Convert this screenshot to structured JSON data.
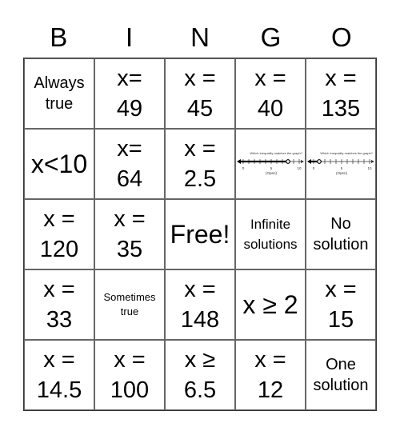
{
  "header": {
    "letters": [
      "B",
      "I",
      "N",
      "G",
      "O"
    ]
  },
  "cells": [
    {
      "text": "Always\ntrue",
      "size": "md"
    },
    {
      "text": "x=\n49",
      "size": "xl"
    },
    {
      "text": "x =\n45",
      "size": "xl"
    },
    {
      "text": "x =\n40",
      "size": "xl"
    },
    {
      "text": "x =\n135",
      "size": "xl"
    },
    {
      "text": "x<10",
      "size": "lg"
    },
    {
      "text": "x=\n64",
      "size": "xl"
    },
    {
      "text": "x =\n2.5",
      "size": "xl"
    },
    {
      "type": "numberline",
      "caption": "Which inequality matches the graph?",
      "circle_at": 8,
      "circle": "open",
      "direction": "left",
      "min": 0,
      "max": 10,
      "ticks": [
        "0",
        "5",
        "10"
      ],
      "label": "(Open)"
    },
    {
      "type": "numberline",
      "caption": "Which inequality matches the graph?",
      "circle_at": 1,
      "circle": "open",
      "direction": "left",
      "min": 0,
      "max": 10,
      "ticks": [
        "0",
        "5",
        "10"
      ],
      "label": "(Open)"
    },
    {
      "text": "x =\n120",
      "size": "xl"
    },
    {
      "text": "x =\n35",
      "size": "xl"
    },
    {
      "text": "Free!",
      "size": "lg"
    },
    {
      "text": "Infinite\nsolutions",
      "size": "sm"
    },
    {
      "text": "No\nsolution",
      "size": "md"
    },
    {
      "text": "x =\n33",
      "size": "xl"
    },
    {
      "text": "Sometimes\ntrue",
      "size": "xs"
    },
    {
      "text": "x =\n148",
      "size": "xl"
    },
    {
      "text": "x ≥ 2",
      "size": "lg"
    },
    {
      "text": "x =\n15",
      "size": "xl"
    },
    {
      "text": "x =\n14.5",
      "size": "xl"
    },
    {
      "text": "x =\n100",
      "size": "xl"
    },
    {
      "text": "x ≥\n6.5",
      "size": "xl"
    },
    {
      "text": "x =\n12",
      "size": "xl"
    },
    {
      "text": "One\nsolution",
      "size": "md"
    }
  ]
}
